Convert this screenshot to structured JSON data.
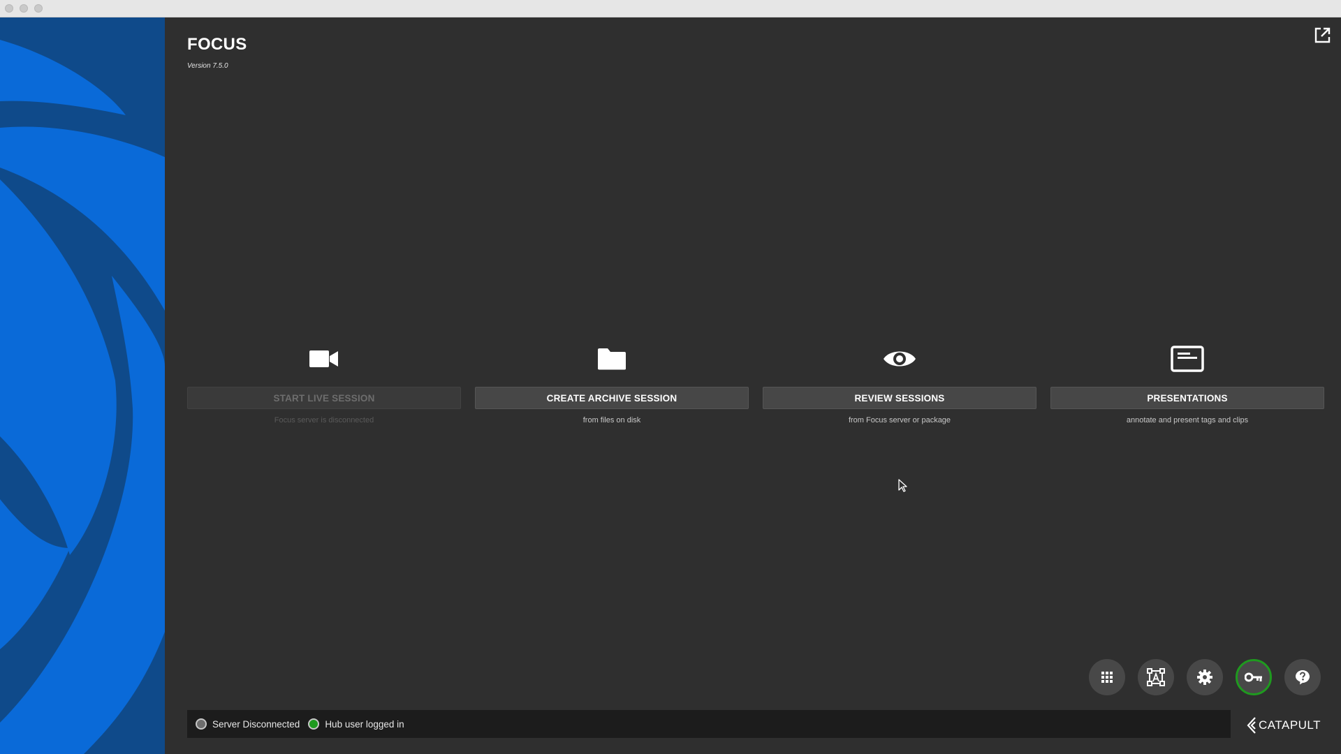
{
  "app": {
    "title": "FOCUS",
    "version": "Version 7.5.0"
  },
  "colors": {
    "sidebar_dark": "#0f4a8a",
    "sidebar_light": "#0a6ad8",
    "background": "#2f2f2f",
    "status_green": "#1f9a1f",
    "status_gray": "#6e6e6e"
  },
  "header": {
    "popout_icon": "open-in-new-window-icon"
  },
  "actions": [
    {
      "icon": "video-camera-icon",
      "label": "START LIVE SESSION",
      "subtitle": "Focus server is disconnected",
      "enabled": false
    },
    {
      "icon": "folder-icon",
      "label": "CREATE ARCHIVE SESSION",
      "subtitle": "from files on disk",
      "enabled": true
    },
    {
      "icon": "eye-icon",
      "label": "REVIEW SESSIONS",
      "subtitle": "from Focus server or package",
      "enabled": true
    },
    {
      "icon": "presentation-icon",
      "label": "PRESENTATIONS",
      "subtitle": "annotate and present tags and clips",
      "enabled": true
    }
  ],
  "toolbar": [
    {
      "icon": "apps-grid-icon",
      "active": false
    },
    {
      "icon": "text-frame-icon",
      "active": false
    },
    {
      "icon": "gear-icon",
      "active": false
    },
    {
      "icon": "key-icon",
      "active": true
    },
    {
      "icon": "help-icon",
      "active": false
    }
  ],
  "status": {
    "server": {
      "text": "Server Disconnected",
      "state": "disconnected"
    },
    "hub": {
      "text": "Hub user logged in",
      "state": "connected"
    }
  },
  "brand": {
    "name": "CATAPULT"
  }
}
